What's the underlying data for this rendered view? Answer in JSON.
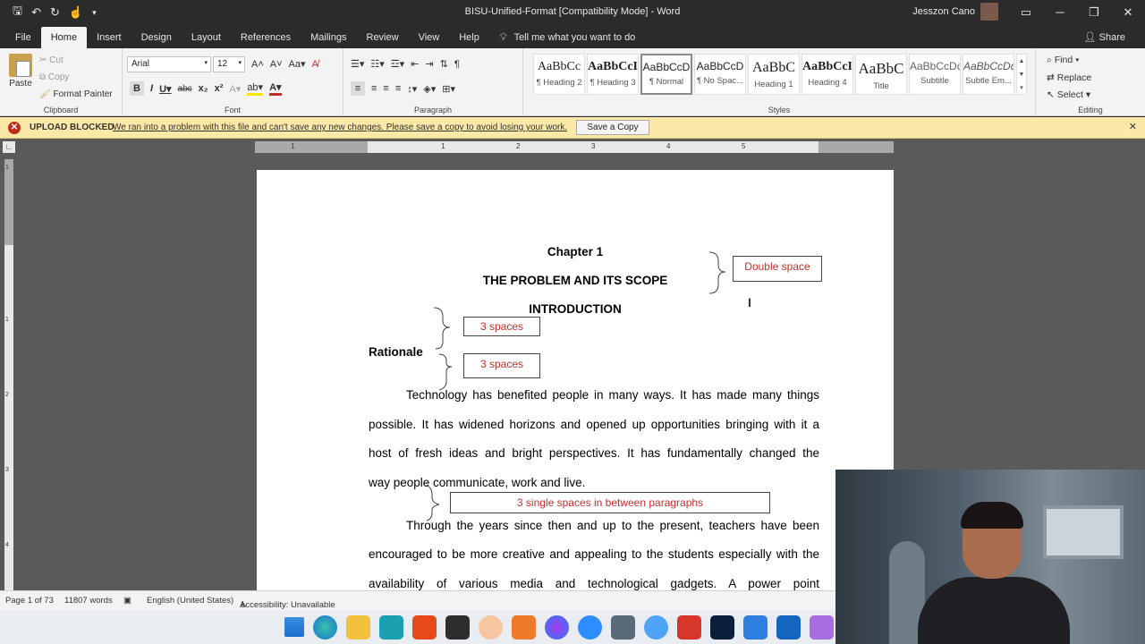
{
  "window": {
    "title": "BISU-Unified-Format [Compatibility Mode]  -  Word",
    "user": "Jesszon Cano"
  },
  "tabs": [
    "File",
    "Home",
    "Insert",
    "Design",
    "Layout",
    "References",
    "Mailings",
    "Review",
    "View",
    "Help"
  ],
  "tell_me": "Tell me what you want to do",
  "share": "Share",
  "clipboard": {
    "paste": "Paste",
    "cut": "Cut",
    "copy": "Copy",
    "format_painter": "Format Painter",
    "label": "Clipboard"
  },
  "font": {
    "name": "Arial",
    "size": "12",
    "label": "Font"
  },
  "paragraph": {
    "label": "Paragraph"
  },
  "styles": {
    "label": "Styles",
    "items": [
      {
        "sample": "AaBbCc",
        "name": "¶ Heading 2"
      },
      {
        "sample": "AaBbCcI",
        "name": "¶ Heading 3"
      },
      {
        "sample": "AaBbCcD",
        "name": "¶ Normal"
      },
      {
        "sample": "AaBbCcD",
        "name": "¶ No Spac..."
      },
      {
        "sample": "AaBbC",
        "name": "Heading 1"
      },
      {
        "sample": "AaBbCcI",
        "name": "Heading 4"
      },
      {
        "sample": "AaBbC",
        "name": "Title"
      },
      {
        "sample": "AaBbCcDd",
        "name": "Subtitle"
      },
      {
        "sample": "AaBbCcDd",
        "name": "Subtle Em..."
      }
    ]
  },
  "editing": {
    "find": "Find",
    "replace": "Replace",
    "select": "Select",
    "label": "Editing"
  },
  "message_bar": {
    "title": "UPLOAD BLOCKED",
    "text": "We ran into a problem with this file and can't save any new changes. Please save a copy to avoid losing your work.",
    "button": "Save a Copy"
  },
  "ruler": {
    "numbers": [
      "1",
      "1",
      "2",
      "3",
      "4",
      "5"
    ]
  },
  "vruler": {
    "numbers": [
      "1",
      "1",
      "2",
      "3",
      "4"
    ]
  },
  "document": {
    "chapter": "Chapter 1",
    "title": "THE PROBLEM AND ITS SCOPE",
    "introduction": "INTRODUCTION",
    "rationale": "Rationale",
    "para1_lines": [
      "Technology has benefited people in many ways. It has made many things",
      "possible. It has widened horizons and opened up opportunities bringing with it a",
      "host of fresh ideas and bright perspectives. It has fundamentally changed the",
      "way people communicate, work and live."
    ],
    "para2_lines": [
      "Through the years since then and up to the present, teachers have been",
      "encouraged to be more creative and appealing to the students especially with the",
      "availability of various media and technological gadgets.  A power point"
    ],
    "annotations": {
      "double_space": "Double space",
      "three_spaces_1": "3 spaces",
      "three_spaces_2": "3 spaces",
      "single_spaces": "3 single spaces in between paragraphs"
    }
  },
  "status": {
    "page": "Page 1 of 73",
    "words": "11807 words",
    "language": "English (United States)",
    "accessibility": "Accessibility: Unavailable"
  },
  "taskbar_icons": [
    "windows-start",
    "edge",
    "file-explorer",
    "app-teal",
    "office",
    "sticky-notes",
    "app-q",
    "app-orange",
    "messenger",
    "zoom",
    "calculator",
    "app-blue-drop",
    "app-red",
    "photoshop",
    "todo",
    "mail",
    "snipping-tool"
  ]
}
